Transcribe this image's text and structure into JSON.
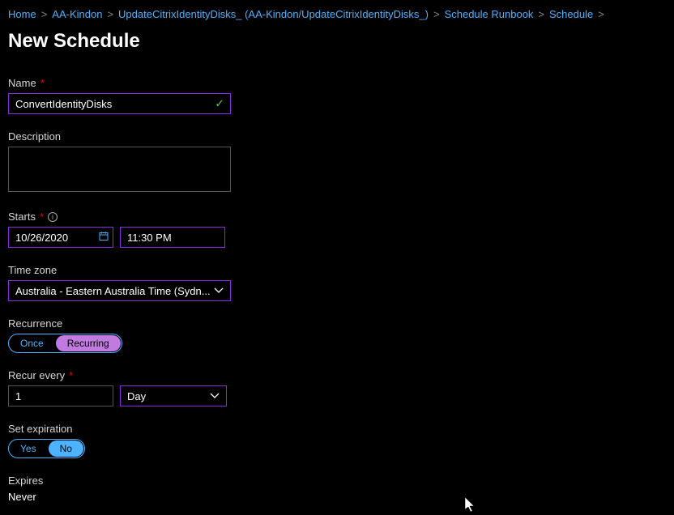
{
  "breadcrumb": {
    "items": [
      "Home",
      "AA-Kindon",
      "UpdateCitrixIdentityDisks_ (AA-Kindon/UpdateCitrixIdentityDisks_)",
      "Schedule Runbook",
      "Schedule"
    ]
  },
  "page": {
    "title": "New Schedule"
  },
  "form": {
    "name_label": "Name",
    "name_value": "ConvertIdentityDisks",
    "description_label": "Description",
    "description_value": "",
    "starts_label": "Starts",
    "starts_date": "10/26/2020",
    "starts_time": "11:30 PM",
    "timezone_label": "Time zone",
    "timezone_value": "Australia - Eastern Australia Time (Sydn...",
    "recurrence_label": "Recurrence",
    "recurrence_once": "Once",
    "recurrence_recurring": "Recurring",
    "recur_every_label": "Recur every",
    "recur_every_value": "1",
    "recur_every_unit": "Day",
    "expiration_label": "Set expiration",
    "expiration_yes": "Yes",
    "expiration_no": "No",
    "expires_label": "Expires",
    "expires_value": "Never"
  }
}
